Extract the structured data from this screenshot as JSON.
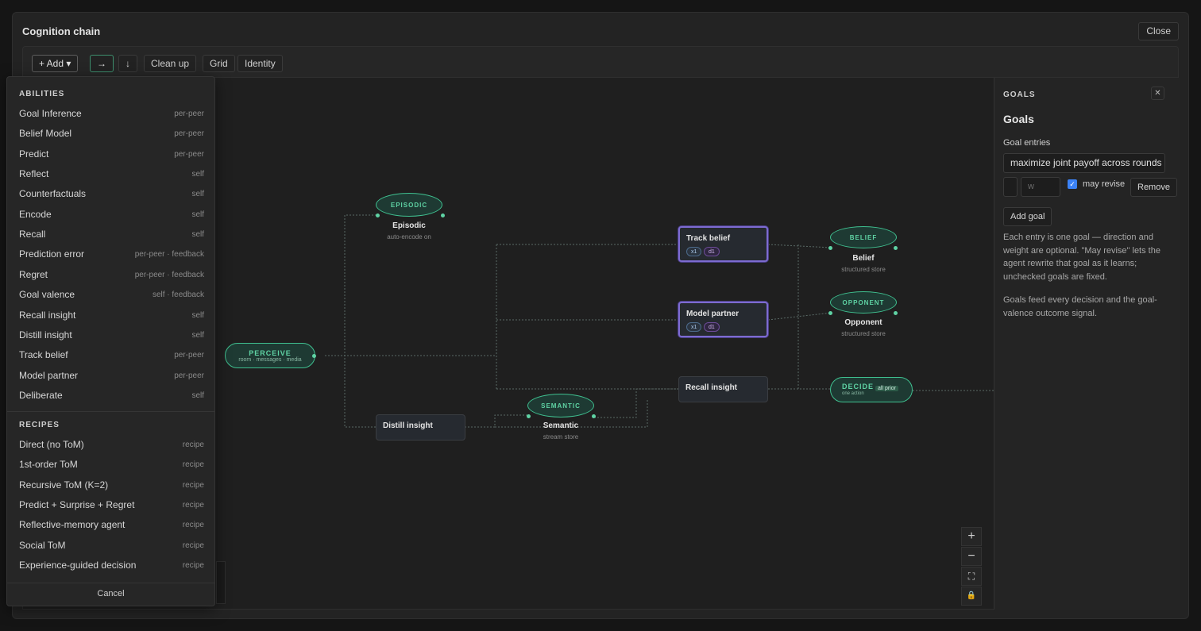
{
  "window": {
    "title": "Cognition chain",
    "close_label": "Close"
  },
  "toolbar": {
    "add_label": "+ Add ▾",
    "dir_right_label": "→",
    "dir_down_label": "↓",
    "cleanup_label": "Clean up",
    "grid_label": "Grid",
    "identity_label": "Identity"
  },
  "graph": {
    "episodic": {
      "tag": "EPISODIC",
      "caption": "Episodic",
      "sub": "auto-encode on"
    },
    "perceive": {
      "tag": "PERCEIVE",
      "sub": "room · messages · media"
    },
    "track_belief": {
      "label": "Track belief",
      "chip_x": "x1",
      "chip_d": "d1"
    },
    "model_partner": {
      "label": "Model partner",
      "chip_x": "x1",
      "chip_d": "d1"
    },
    "belief": {
      "tag": "BELIEF",
      "caption": "Belief",
      "sub": "structured store"
    },
    "opponent": {
      "tag": "OPPONENT",
      "caption": "Opponent",
      "sub": "structured store"
    },
    "recall_insight": {
      "label": "Recall insight"
    },
    "decide": {
      "tag": "DECIDE",
      "sub": "one action",
      "chip": "all prior"
    },
    "distill_insight": {
      "label": "Distill insight"
    },
    "semantic": {
      "tag": "SEMANTIC",
      "caption": "Semantic",
      "sub": "stream store"
    }
  },
  "zoom": {
    "in": "+",
    "out": "−",
    "fit": "⛶",
    "lock": "🔒"
  },
  "goals_panel": {
    "header": "GOALS",
    "close": "✕",
    "title": "Goals",
    "entries_label": "Goal entries",
    "goal_text": "maximize joint payoff across rounds",
    "weight_placeholder": "w",
    "may_revise_label": "may revise",
    "may_revise_checked": "✓",
    "remove_label": "Remove",
    "add_goal_label": "Add goal",
    "help_1": "Each entry is one goal — direction and weight are optional. \"May revise\" lets the agent rewrite that goal as it learns; unchecked goals are fixed.",
    "help_2": "Goals feed every decision and the goal-valence outcome signal."
  },
  "add_menu": {
    "abilities_header": "ABILITIES",
    "abilities": [
      {
        "name": "Goal Inference",
        "tag": "per-peer"
      },
      {
        "name": "Belief Model",
        "tag": "per-peer"
      },
      {
        "name": "Predict",
        "tag": "per-peer"
      },
      {
        "name": "Reflect",
        "tag": "self"
      },
      {
        "name": "Counterfactuals",
        "tag": "self"
      },
      {
        "name": "Encode",
        "tag": "self"
      },
      {
        "name": "Recall",
        "tag": "self"
      },
      {
        "name": "Prediction error",
        "tag": "per-peer · feedback"
      },
      {
        "name": "Regret",
        "tag": "per-peer · feedback"
      },
      {
        "name": "Goal valence",
        "tag": "self · feedback"
      },
      {
        "name": "Recall insight",
        "tag": "self"
      },
      {
        "name": "Distill insight",
        "tag": "self"
      },
      {
        "name": "Track belief",
        "tag": "per-peer"
      },
      {
        "name": "Model partner",
        "tag": "per-peer"
      },
      {
        "name": "Deliberate",
        "tag": "self"
      }
    ],
    "recipes_header": "RECIPES",
    "recipes": [
      {
        "name": "Direct (no ToM)",
        "tag": "recipe"
      },
      {
        "name": "1st-order ToM",
        "tag": "recipe"
      },
      {
        "name": "Recursive ToM (K=2)",
        "tag": "recipe"
      },
      {
        "name": "Predict + Surprise + Regret",
        "tag": "recipe"
      },
      {
        "name": "Reflective-memory agent",
        "tag": "recipe"
      },
      {
        "name": "Social ToM",
        "tag": "recipe"
      },
      {
        "name": "Experience-guided decision",
        "tag": "recipe"
      }
    ],
    "cancel_label": "Cancel"
  },
  "colors": {
    "accent_green": "#3fbf8f",
    "selection_purple": "#7d6bd1",
    "checkbox_blue": "#3b82f6"
  }
}
